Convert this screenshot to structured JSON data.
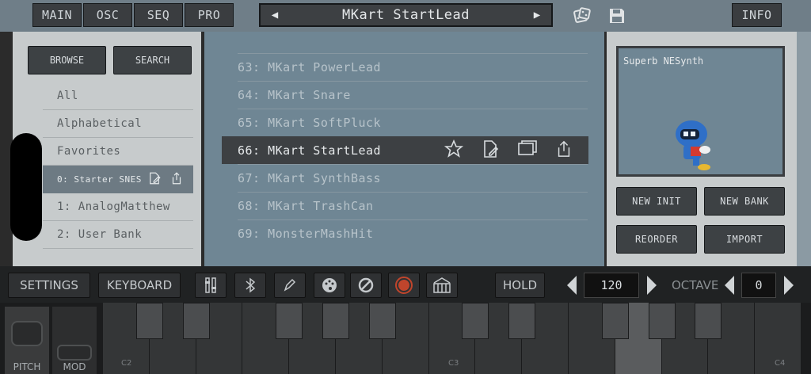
{
  "top_tabs": [
    "MAIN",
    "OSC",
    "SEQ",
    "PRO"
  ],
  "preset": {
    "name": "MKart StartLead"
  },
  "info_label": "INFO",
  "left": {
    "browse_label": "BROWSE",
    "search_label": "SEARCH",
    "items": [
      "All",
      "Alphabetical",
      "Favorites",
      "0: Starter SNES",
      "1: AnalogMatthew",
      "2: User Bank"
    ],
    "selected_index": 3
  },
  "presets": [
    "63: MKart PowerLead",
    "64: MKart Snare",
    "65: MKart SoftPluck",
    "66: MKart StartLead",
    "67: MKart SynthBass",
    "68: MKart TrashCan",
    "69: MonsterMashHit"
  ],
  "selected_preset_index": 3,
  "screen": {
    "title": "Superb NESynth"
  },
  "right_buttons": {
    "new_init": "NEW INIT",
    "new_bank": "NEW BANK",
    "reorder": "REORDER",
    "import": "IMPORT"
  },
  "toolbar": {
    "settings": "SETTINGS",
    "keyboard": "KEYBOARD",
    "hold": "HOLD",
    "tempo": "120",
    "octave_label": "OCTAVE",
    "octave": "0",
    "icons": [
      "sliders-icon",
      "bluetooth-icon",
      "pencil-icon",
      "palette-icon",
      "block-icon",
      "record-icon",
      "piano-icon"
    ]
  },
  "keyboard": {
    "pitch_label": "PITCH",
    "mod_label": "MOD",
    "key_labels": [
      "C2",
      "C3",
      "C4"
    ]
  },
  "colors": {
    "accent_record": "#c0452c",
    "selected_row": "#3d4043",
    "list_bg": "#6f8694"
  }
}
